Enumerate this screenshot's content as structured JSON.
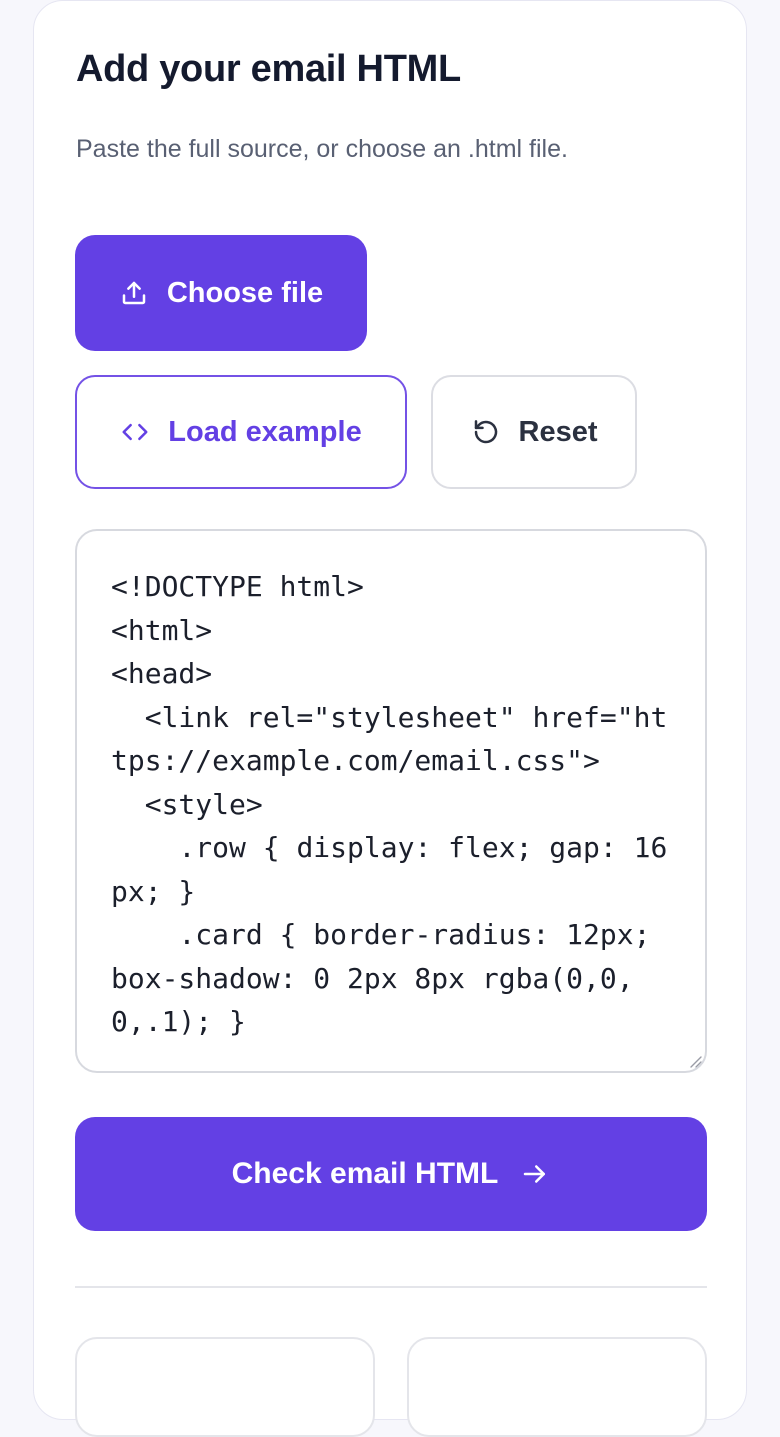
{
  "panel": {
    "title": "Add your email HTML",
    "subtitle": "Paste the full source, or choose an .html file."
  },
  "actions": {
    "choose_file": "Choose file",
    "load_example": "Load example",
    "reset": "Reset",
    "check": "Check email HTML"
  },
  "editor": {
    "content": "<!DOCTYPE html>\n<html>\n<head>\n  <link rel=\"stylesheet\" href=\"https://example.com/email.css\">\n  <style>\n    .row { display: flex; gap: 16px; }\n    .card { border-radius: 12px; box-shadow: 0 2px 8px rgba(0,0,0,.1); }"
  },
  "icons": {
    "choose_file": "upload-icon",
    "load_example": "code-icon",
    "reset": "rotate-ccw-icon",
    "check": "arrow-right-icon"
  },
  "colors": {
    "accent": "#6340e4",
    "title": "#141a2e",
    "muted": "#596073",
    "border": "#dcdde3"
  }
}
